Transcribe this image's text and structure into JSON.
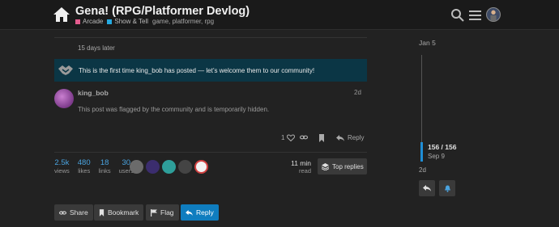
{
  "header": {
    "title": "Gena! (RPG/Platformer Devlog)",
    "categories": [
      {
        "label": "Arcade",
        "color": "#e45c8e"
      },
      {
        "label": "Show & Tell",
        "color": "#25aae1"
      }
    ],
    "tags": "game, platformer, rpg"
  },
  "topic": {
    "gap_label": "15 days later",
    "welcome_text": "This is the first time king_bob has posted — let’s welcome them to our community!",
    "post": {
      "username": "king_bob",
      "time": "2d",
      "hidden_message": "This post was flagged by the community and is temporarily hidden.",
      "like_count": "1",
      "reply_label": "Reply"
    }
  },
  "stats": [
    {
      "value": "2.5k",
      "label": "views"
    },
    {
      "value": "480",
      "label": "likes"
    },
    {
      "value": "18",
      "label": "links"
    },
    {
      "value": "30",
      "label": "users"
    }
  ],
  "read_time": {
    "value": "11 min",
    "label": "read"
  },
  "top_replies_label": "Top replies",
  "footer_buttons": {
    "share": "Share",
    "bookmark": "Bookmark",
    "flag": "Flag",
    "reply": "Reply"
  },
  "timeline": {
    "start_date": "Jan 5",
    "position": "156 / 156",
    "position_date": "Sep 9",
    "end_label": "2d"
  },
  "colors": {
    "accent": "#0f7dbf",
    "welcome_bg": "#0b3645",
    "stat_number": "#4aa3df"
  }
}
